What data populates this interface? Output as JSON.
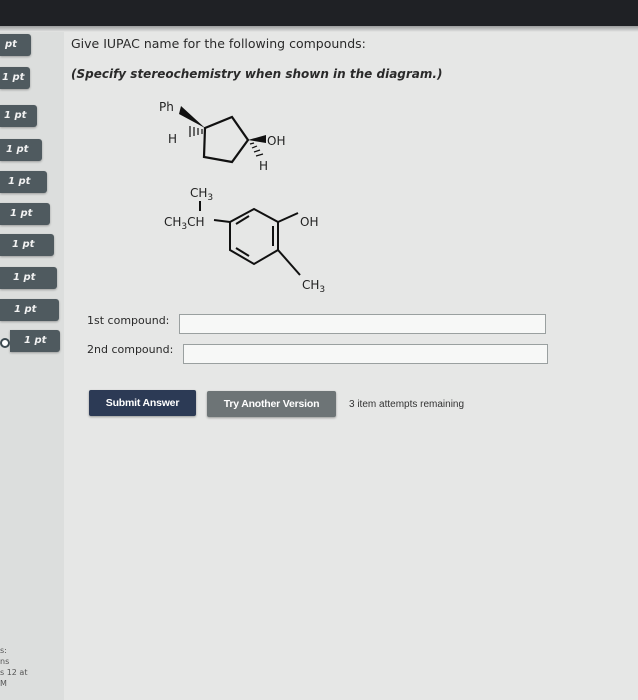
{
  "sidebar": {
    "points": [
      "pt",
      "1 pt",
      "1 pt",
      "1 pt",
      "1 pt",
      "1 pt",
      "1 pt",
      "1 pt",
      "1 pt",
      "1 pt"
    ],
    "footer_lines": [
      "s:",
      "ns",
      "s 12 at",
      "M"
    ]
  },
  "question": {
    "title": "Give IUPAC name for the following compounds:",
    "note": "(Specify stereochemistry when shown in the diagram.)"
  },
  "molecule1": {
    "ph": "Ph",
    "h_left": "H",
    "oh": "OH",
    "h_right": "H"
  },
  "molecule2": {
    "ch3_top": "CH",
    "ch3_top_sub": "3",
    "ch3ch": "CH",
    "ch3ch_sub": "3",
    "ch3ch_tail": "CH",
    "oh": "OH",
    "ch3_bottom": "CH",
    "ch3_bottom_sub": "3"
  },
  "answers": {
    "first_label": "1st compound:",
    "second_label": "2nd compound:",
    "first_value": "",
    "second_value": ""
  },
  "actions": {
    "submit": "Submit Answer",
    "try_another": "Try Another Version",
    "attempts": "3 item attempts remaining"
  }
}
